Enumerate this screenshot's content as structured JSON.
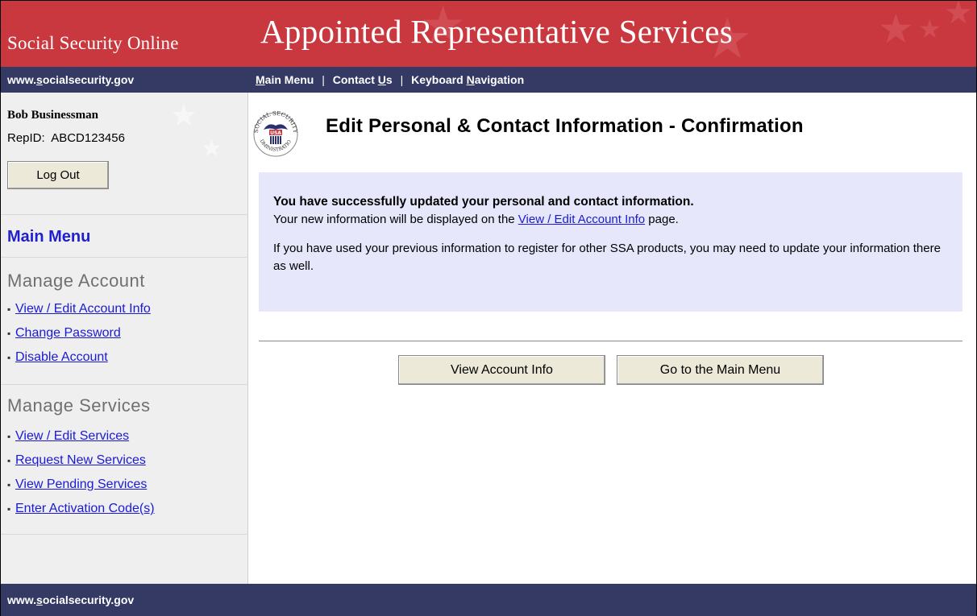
{
  "header": {
    "site_name": "Social Security Online",
    "app_title": "Appointed Representative Services",
    "colors": {
      "banner": "#c8383e",
      "nav": "#343a64",
      "sidebar": "#efefef",
      "confirm_box": "#e6e7fb",
      "link": "#1a1ad6"
    }
  },
  "nav": {
    "domain_pre": "www.",
    "domain_u": "s",
    "domain_post": "ocialsecurity.gov",
    "links": [
      {
        "u": "M",
        "rest": "ain Menu"
      },
      {
        "pre": "Contact ",
        "u": "U",
        "rest": "s"
      },
      {
        "pre": "Keyboard ",
        "u": "N",
        "rest": "avigation"
      }
    ],
    "separator": "|"
  },
  "sidebar": {
    "user_name": "Bob Businessman",
    "rep_id_label": "RepID:",
    "rep_id_value": "ABCD123456",
    "logout_label": "Log Out",
    "main_menu_label": "Main Menu",
    "manage_account": {
      "heading": "Manage Account",
      "items": [
        "View / Edit Account Info",
        "Change Password",
        "Disable Account"
      ]
    },
    "manage_services": {
      "heading": "Manage Services",
      "items": [
        "View / Edit Services",
        "Request New Services",
        "View Pending Services",
        "Enter Activation Code(s)"
      ]
    },
    "bullet": "▪"
  },
  "main": {
    "page_title": "Edit Personal & Contact Information - Confirmation",
    "seal_text_top": "SOCIAL SECURITY",
    "seal_text_bottom": "ADMINISTRATION",
    "seal_usa": "USA",
    "confirmation": {
      "headline": "You have successfully updated your personal and contact information.",
      "line2_pre": "Your new information will be displayed on the ",
      "line2_link": "View / Edit Account Info",
      "line2_post": " page.",
      "line3": "If you have used your previous information to register for other SSA products, you may need to update your information there as well."
    },
    "buttons": {
      "view_account": "View Account Info",
      "main_menu": "Go to the Main Menu"
    }
  },
  "footer": {
    "domain_pre": "www.",
    "domain_u": "s",
    "domain_post": "ocialsecurity.gov"
  }
}
